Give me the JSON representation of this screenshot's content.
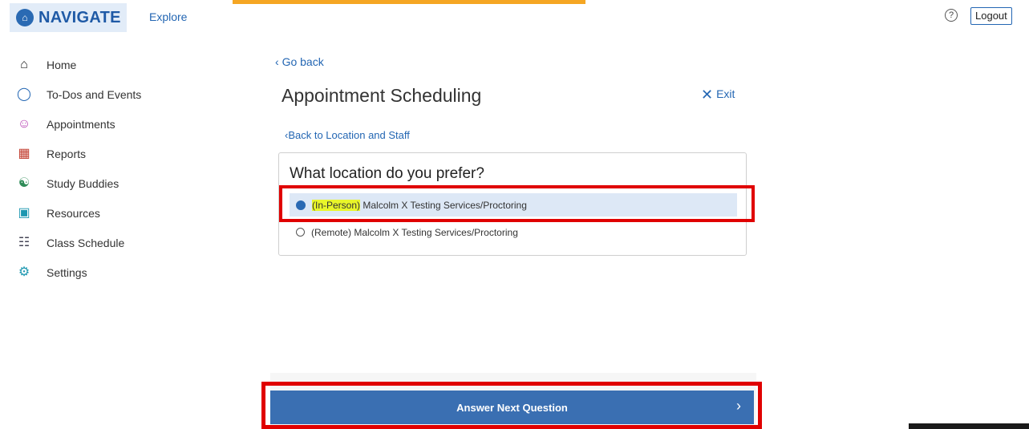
{
  "header": {
    "logo_text": "NAVIGATE",
    "explore": "Explore",
    "help_icon": "?",
    "logout": "Logout"
  },
  "sidebar": {
    "items": [
      {
        "label": "Home",
        "icon": "home-icon"
      },
      {
        "label": "To-Dos and Events",
        "icon": "apple-icon"
      },
      {
        "label": "Appointments",
        "icon": "person-icon"
      },
      {
        "label": "Reports",
        "icon": "report-icon"
      },
      {
        "label": "Study Buddies",
        "icon": "group-icon"
      },
      {
        "label": "Resources",
        "icon": "resources-icon"
      },
      {
        "label": "Class Schedule",
        "icon": "book-icon"
      },
      {
        "label": "Settings",
        "icon": "gear-icon"
      }
    ]
  },
  "main": {
    "go_back": "Go back",
    "title": "Appointment Scheduling",
    "exit": "Exit",
    "back_location": "Back to Location and Staff",
    "question": "What location do you prefer?",
    "options": [
      {
        "highlight": "(In-Person)",
        "label": " Malcolm X Testing Services/Proctoring",
        "selected": true
      },
      {
        "label": "(Remote) Malcolm X Testing Services/Proctoring",
        "selected": false
      }
    ],
    "next_button": "Answer Next Question"
  },
  "colors": {
    "accent": "#2366b3",
    "button": "#3a6fb2",
    "annotation_red": "#e00000",
    "progress": "#f5a623"
  }
}
